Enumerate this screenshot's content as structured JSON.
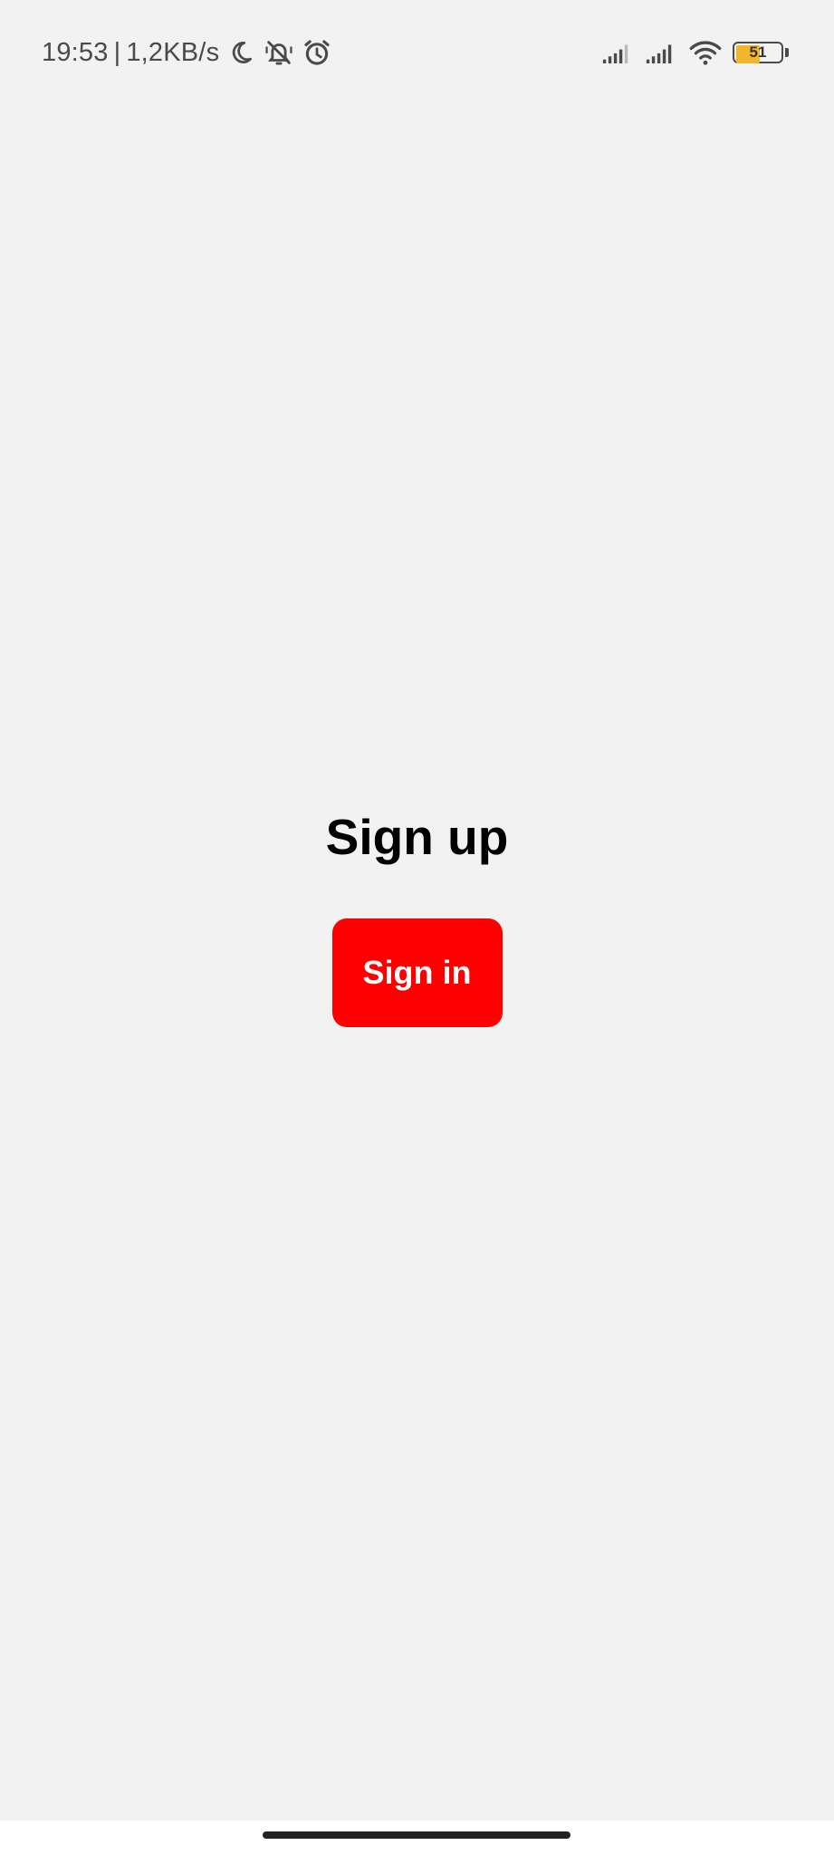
{
  "status_bar": {
    "time": "19:53",
    "separator": "|",
    "network_speed": "1,2KB/s",
    "icons_left": [
      "moon-icon",
      "bell-muted-icon",
      "alarm-icon"
    ],
    "icons_right": [
      "signal-icon",
      "signal-icon",
      "wifi-icon"
    ],
    "battery_level": "51"
  },
  "main": {
    "title": "Sign up",
    "sign_in_label": "Sign in"
  },
  "colors": {
    "background": "#f2f2f2",
    "accent": "#ff0000",
    "battery": "#f3b52c"
  }
}
